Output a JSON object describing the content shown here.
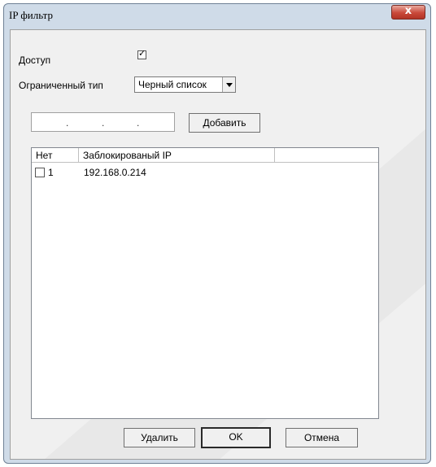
{
  "window": {
    "title": "IP фильтр",
    "close_label": "x"
  },
  "form": {
    "access_label": "Доступ",
    "access_checked": true,
    "restriction_type_label": "Ограниченный тип",
    "restriction_type_value": "Черный список",
    "ip_input_dots": [
      ".",
      ".",
      "."
    ],
    "add_button": "Добавить"
  },
  "table": {
    "columns": [
      "Нет",
      "Заблокированый IP"
    ],
    "rows": [
      {
        "checked": false,
        "num": "1",
        "ip": "192.168.0.214"
      }
    ]
  },
  "buttons": {
    "delete": "Удалить",
    "ok": "OK",
    "cancel": "Отмена"
  },
  "colors": {
    "frame": "#cfdbe8",
    "client": "#f0f0f0",
    "close": "#c9493a"
  }
}
